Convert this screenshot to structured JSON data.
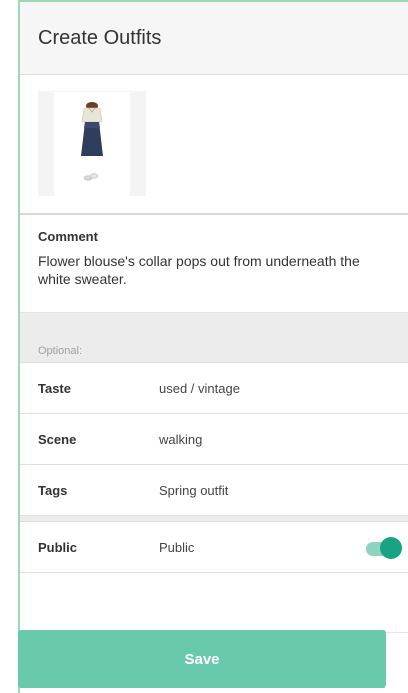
{
  "header": {
    "title": "Create Outfits"
  },
  "outfit_image": {
    "icon": "outfit-photo"
  },
  "comment": {
    "label": "Comment",
    "text": "Flower blouse's collar pops out from underneath the white sweater."
  },
  "optional": {
    "label": "Optional:"
  },
  "fields": {
    "taste": {
      "label": "Taste",
      "value": "used / vintage"
    },
    "scene": {
      "label": "Scene",
      "value": "walking"
    },
    "tags": {
      "label": "Tags",
      "value": "Spring outfit"
    }
  },
  "public": {
    "label": "Public",
    "value": "Public",
    "toggle_on": true
  },
  "actions": {
    "save_label": "Save"
  },
  "colors": {
    "accent": "#1aa383",
    "button": "#68c9ad"
  }
}
